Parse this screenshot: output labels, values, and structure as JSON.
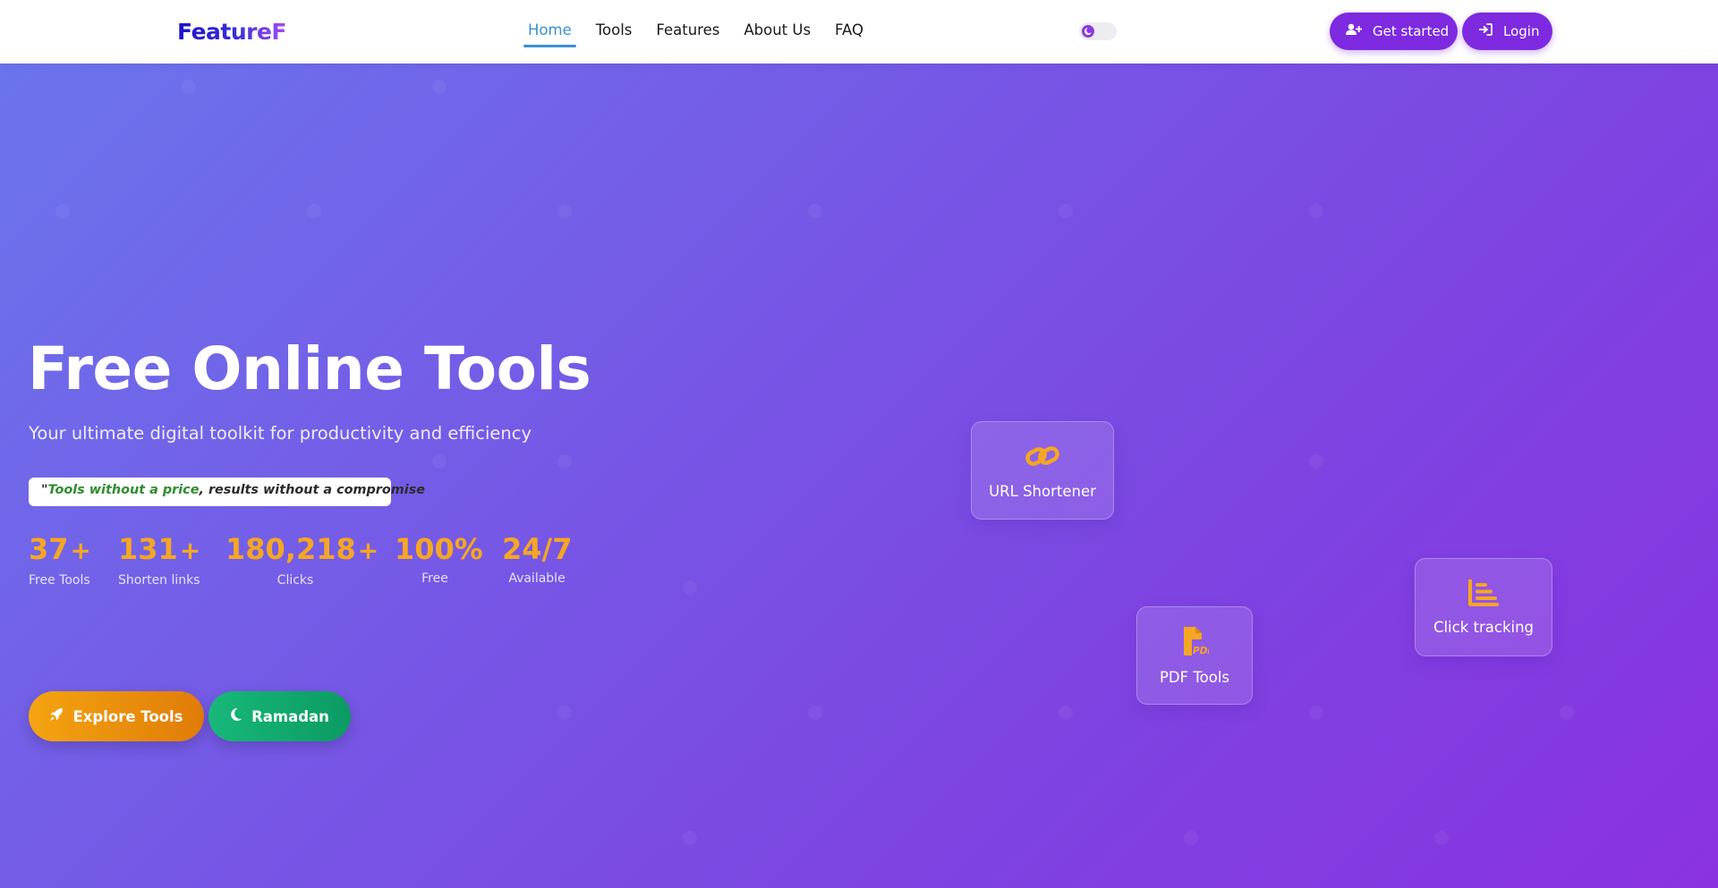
{
  "navbar": {
    "logo": "FeatureF",
    "links": [
      {
        "label": "Home",
        "active": true
      },
      {
        "label": "Tools",
        "active": false
      },
      {
        "label": "Features",
        "active": false
      },
      {
        "label": "About Us",
        "active": false
      },
      {
        "label": "FAQ",
        "active": false
      }
    ],
    "theme_toggle_icon": "moon-icon",
    "get_started_label": "Get started",
    "get_started_icon": "user-plus-icon",
    "login_label": "Login",
    "login_icon": "sign-in-icon"
  },
  "hero": {
    "title": "Free Online Tools",
    "subtitle": "Your ultimate digital toolkit for productivity and efficiency",
    "quote": {
      "open_mark": "\"",
      "highlight": "Tools without a price",
      "rest": ", results without a compromise"
    },
    "stats": [
      {
        "value": "37",
        "suffix": "+",
        "label": "Free Tools"
      },
      {
        "value": "131",
        "suffix": "+",
        "label": "Shorten links"
      },
      {
        "value": "180,218",
        "suffix": "+",
        "label": "Clicks"
      },
      {
        "value": "100%",
        "suffix": "",
        "label": "Free"
      },
      {
        "value": "24/7",
        "suffix": "",
        "label": "Available"
      }
    ],
    "buttons": {
      "explore_label": "Explore Tools",
      "explore_icon": "rocket-icon",
      "ramadan_label": "Ramadan",
      "ramadan_icon": "crescent-moon-icon"
    },
    "feature_cards": [
      {
        "label": "URL Shortener",
        "icon": "link-icon"
      },
      {
        "label": "PDF Tools",
        "icon": "pdf-file-icon",
        "icon_text": "PDF"
      },
      {
        "label": "Click tracking",
        "icon": "bar-chart-icon"
      }
    ]
  },
  "colors": {
    "brand_purple": "#7d2ae0",
    "accent_orange": "#f5a623",
    "active_nav_blue": "#3b8fd4",
    "quote_green": "#2f8c2f",
    "ramadan_green": "#18b87a"
  }
}
